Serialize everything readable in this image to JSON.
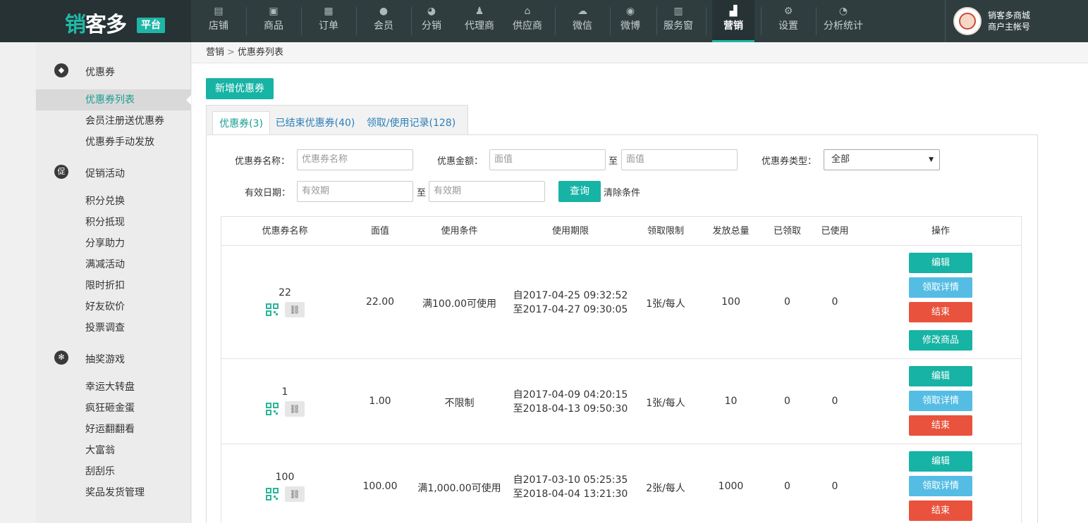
{
  "brand": {
    "logo_text_a": "销",
    "logo_text_b": "客多",
    "badge": "平台"
  },
  "nav": [
    {
      "label": "店铺",
      "icon": "store-icon"
    },
    {
      "label": "商品",
      "icon": "bag-icon"
    },
    {
      "label": "订单",
      "icon": "order-icon"
    },
    {
      "label": "会员",
      "icon": "member-icon"
    },
    {
      "label": "分销",
      "icon": "pie-icon"
    },
    {
      "label": "代理商",
      "icon": "agent-icon"
    },
    {
      "label": "供应商",
      "icon": "supplier-icon"
    },
    {
      "label": "微信",
      "icon": "wechat-icon"
    },
    {
      "label": "微博",
      "icon": "weibo-icon"
    },
    {
      "label": "服务窗",
      "icon": "service-icon"
    },
    {
      "label": "营销",
      "icon": "chart-icon"
    },
    {
      "label": "设置",
      "icon": "gear-icon"
    },
    {
      "label": "分析统计",
      "icon": "analytics-icon"
    }
  ],
  "user": {
    "name": "销客多商城",
    "account": "商户主帐号"
  },
  "sidebar": {
    "coupon_group": "优惠券",
    "coupon_items": [
      "优惠券列表",
      "会员注册送优惠券",
      "优惠券手动发放"
    ],
    "promo_group": "促销活动",
    "promo_items": [
      "积分兑换",
      "积分抵现",
      "分享助力",
      "满减活动",
      "限时折扣",
      "好友砍价",
      "投票调查"
    ],
    "game_group": "抽奖游戏",
    "game_items": [
      "幸运大转盘",
      "疯狂砸金蛋",
      "好运翻翻看",
      "大富翁",
      "刮刮乐",
      "奖品发货管理"
    ]
  },
  "breadcrumb": {
    "parent": "营销",
    "sep": ">",
    "current": "优惠券列表"
  },
  "add_button": "新增优惠券",
  "tabs": [
    "优惠券(3)",
    "已结束优惠券(40)",
    "领取/使用记录(128)"
  ],
  "filters": {
    "name_label": "优惠券名称：",
    "name_placeholder": "优惠券名称",
    "amount_label": "优惠金额：",
    "amount_placeholder": "面值",
    "to": "至",
    "type_label": "优惠券类型：",
    "type_value": "全部",
    "date_label": "有效日期：",
    "date_placeholder": "有效期",
    "query": "查询",
    "clear": "清除条件"
  },
  "table": {
    "headers": [
      "优惠券名称",
      "面值",
      "使用条件",
      "使用期限",
      "领取限制",
      "发放总量",
      "已领取",
      "已使用",
      "操作"
    ],
    "rows": [
      {
        "name": "22",
        "value": "22.00",
        "condition": "满100.00可使用",
        "from": "自2017-04-25 09:32:52",
        "to": "至2017-04-27 09:30:05",
        "limit": "1张/每人",
        "total": "100",
        "received": "0",
        "used": "0"
      },
      {
        "name": "1",
        "value": "1.00",
        "condition": "不限制",
        "from": "自2017-04-09 04:20:15",
        "to": "至2018-04-13 09:50:30",
        "limit": "1张/每人",
        "total": "10",
        "received": "0",
        "used": "0"
      },
      {
        "name": "100",
        "value": "100.00",
        "condition": "满1,000.00可使用",
        "from": "自2017-03-10 05:25:35",
        "to": "至2018-04-04 13:21:30",
        "limit": "2张/每人",
        "total": "1000",
        "received": "0",
        "used": "0"
      }
    ],
    "ops": {
      "edit": "编辑",
      "detail": "领取详情",
      "end": "结束",
      "modify": "修改商品"
    }
  },
  "colors": {
    "accent": "#17b3a5",
    "info": "#55bde4",
    "danger": "#e9523c",
    "topbar": "#2f3d3f"
  }
}
